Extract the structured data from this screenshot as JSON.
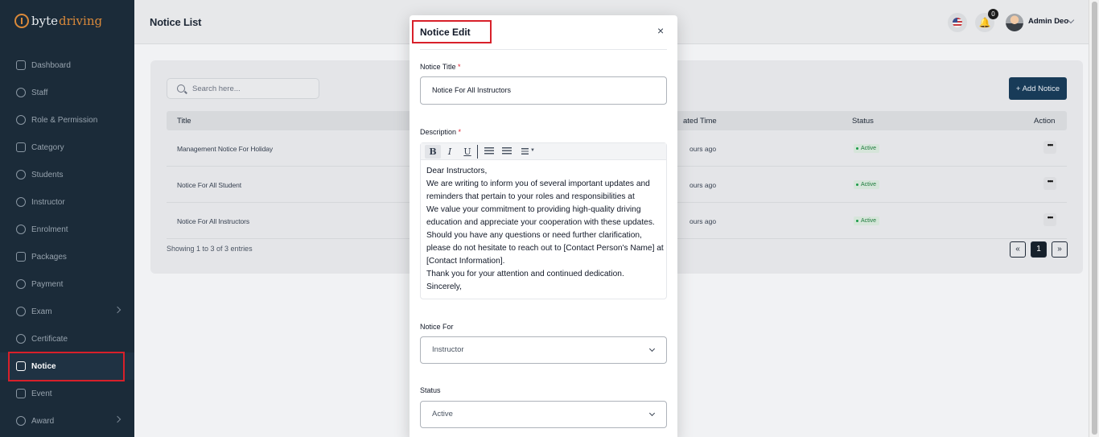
{
  "app": {
    "logo_byte": "byte",
    "logo_driving": "driving"
  },
  "sidebar": {
    "items": [
      {
        "label": "Dashboard",
        "icon": "grid-icon"
      },
      {
        "label": "Staff",
        "icon": "user-icon"
      },
      {
        "label": "Role & Permission",
        "icon": "shield-icon"
      },
      {
        "label": "Category",
        "icon": "folder-icon"
      },
      {
        "label": "Students",
        "icon": "users-icon"
      },
      {
        "label": "Instructor",
        "icon": "user-icon"
      },
      {
        "label": "Enrolment",
        "icon": "enrolment-icon"
      },
      {
        "label": "Packages",
        "icon": "layers-icon"
      },
      {
        "label": "Payment",
        "icon": "dollar-icon"
      },
      {
        "label": "Exam",
        "icon": "exam-icon"
      },
      {
        "label": "Certificate",
        "icon": "certificate-icon"
      },
      {
        "label": "Notice",
        "icon": "notice-icon"
      },
      {
        "label": "Event",
        "icon": "calendar-icon"
      },
      {
        "label": "Award",
        "icon": "award-icon"
      }
    ],
    "active": "Notice"
  },
  "header": {
    "page_title": "Notice List",
    "notification_count": "0",
    "user_name": "Admin Deo"
  },
  "list": {
    "search_placeholder": "Search here...",
    "add_button": "+ Add Notice",
    "columns": {
      "title": "Title",
      "created_time": "ated Time",
      "status": "Status",
      "action": "Action"
    },
    "rows": [
      {
        "title": "Management Notice For Holiday",
        "time": "ours ago",
        "status": "Active",
        "action": "•••"
      },
      {
        "title": "Notice For All Student",
        "time": "ours ago",
        "status": "Active",
        "action": "•••"
      },
      {
        "title": "Notice For All Instructors",
        "time": "ours ago",
        "status": "Active",
        "action": "•••"
      }
    ],
    "showing": "Showing 1 to 3 of 3 entries",
    "pagination": {
      "prev": "«",
      "page": "1",
      "next": "»"
    }
  },
  "modal": {
    "title": "Notice Edit",
    "close": "×",
    "notice_title_label": "Notice Title",
    "notice_title_value": "Notice For All Instructors",
    "required_mark": "*",
    "description_label": "Description",
    "toolbar": {
      "bold": "B",
      "italic": "I",
      "underline": "U"
    },
    "description_lines": [
      "Dear Instructors,",
      "We are writing to inform you of several important updates and reminders that pertain to your roles and responsibilities at",
      "We value your commitment to providing high-quality driving education and appreciate your cooperation with these updates. Should you have any questions or need further clarification, please do not hesitate to reach out to [Contact Person's Name] at [Contact Information].",
      "Thank you for your attention and continued dedication.",
      "Sincerely,"
    ],
    "notice_for_label": "Notice For",
    "notice_for_value": "Instructor",
    "status_label": "Status",
    "status_value": "Active"
  }
}
